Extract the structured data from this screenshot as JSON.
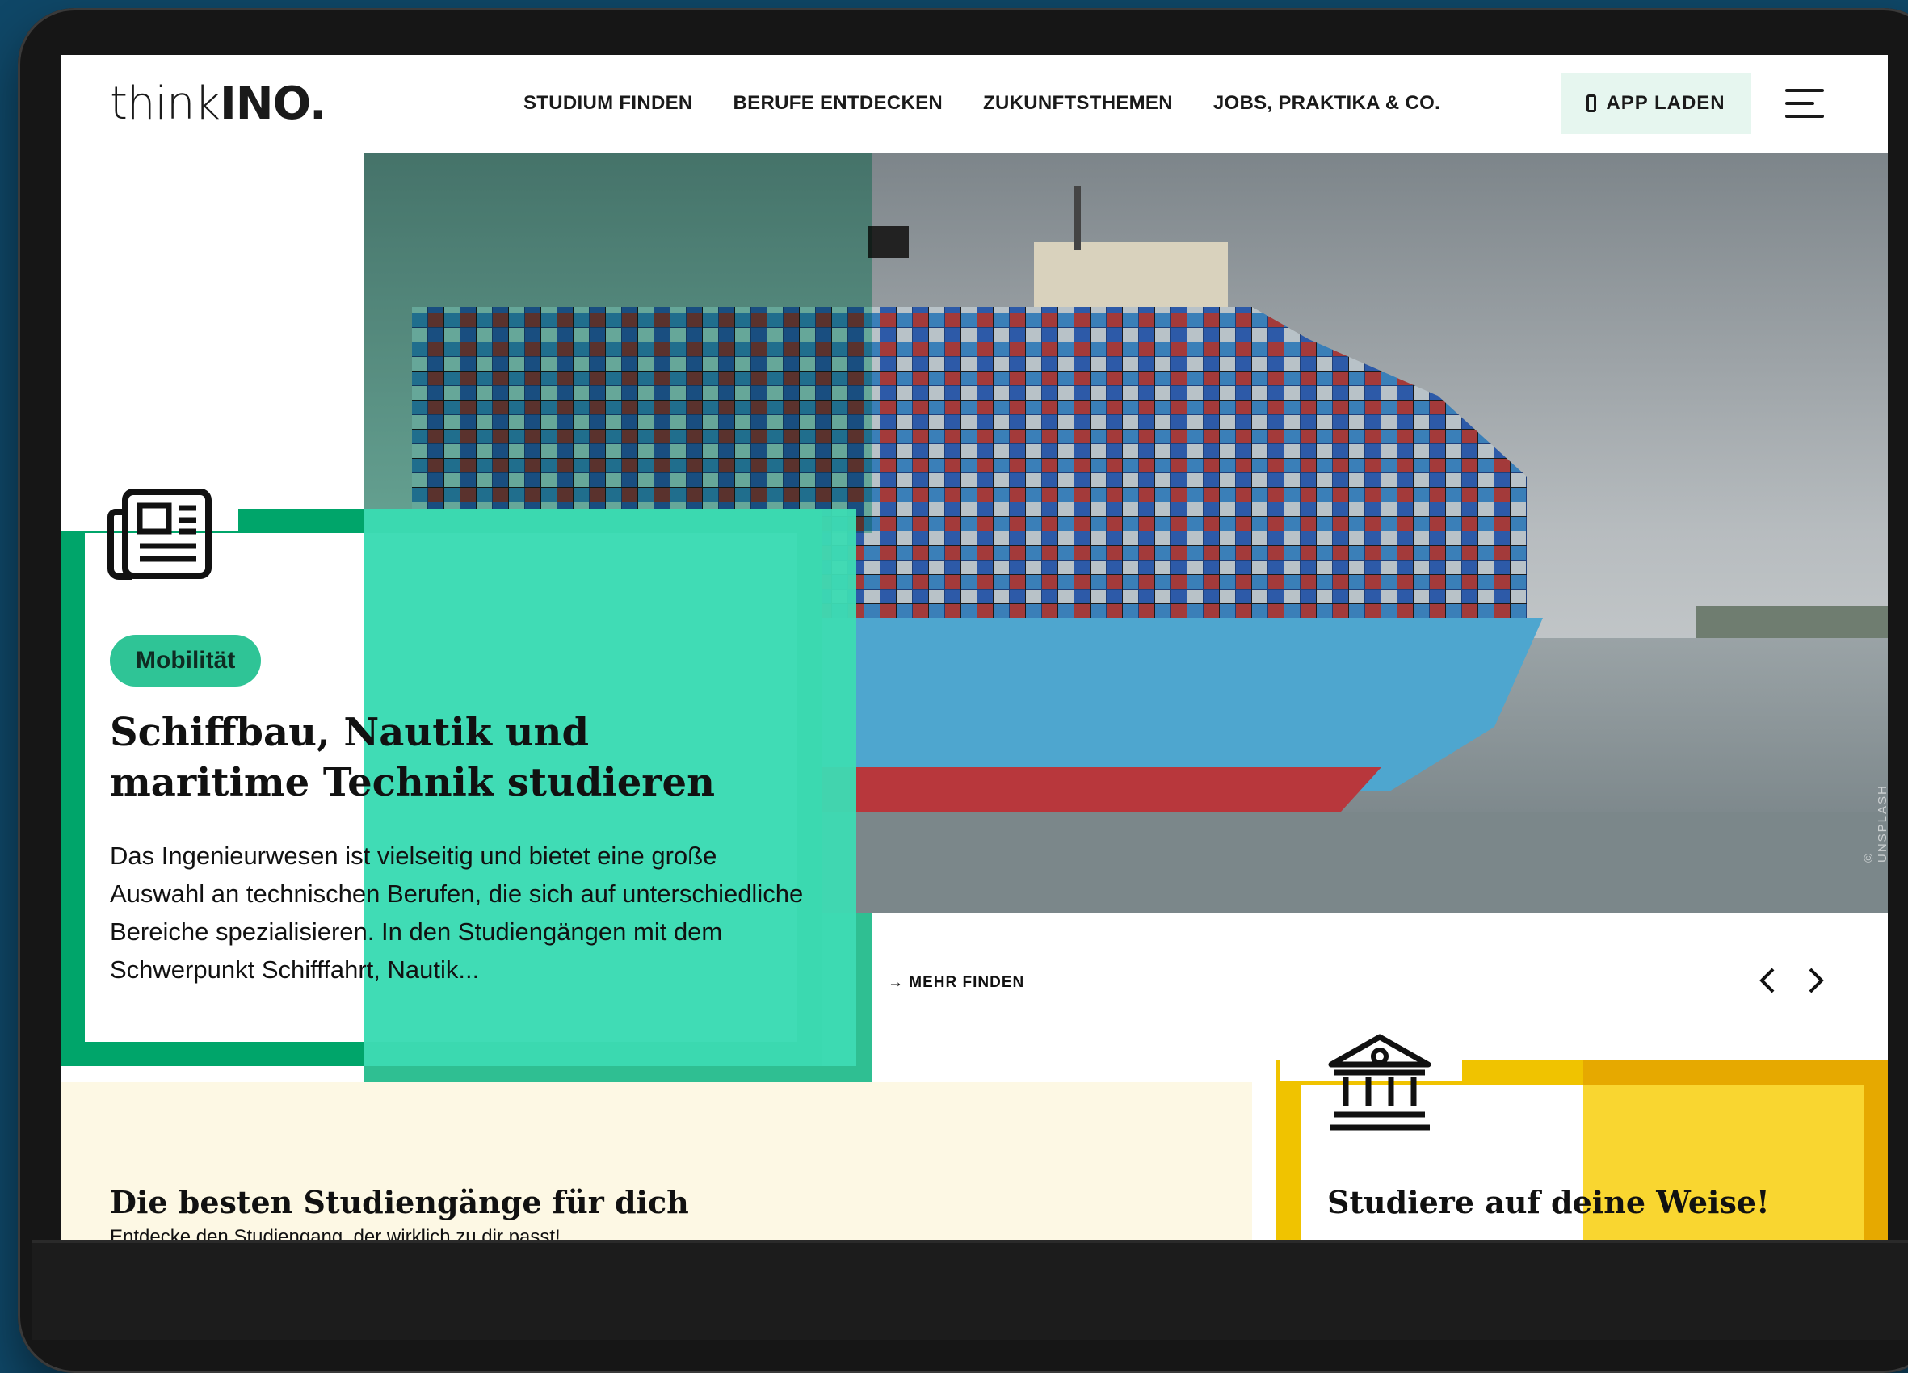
{
  "brand": {
    "logo_light": "think",
    "logo_bold": "INO."
  },
  "nav": {
    "items": [
      "STUDIUM FINDEN",
      "BERUFE ENTDECKEN",
      "ZUKUNFTSTHEMEN",
      "JOBS, PRAKTIKA & CO."
    ]
  },
  "header": {
    "app_button_label": "APP LADEN"
  },
  "hero": {
    "tag": "Mobilität",
    "title_line1": "Schiffbau, Nautik und",
    "title_line2": "maritime Technik studieren",
    "text": "Das Ingenieurwesen ist vielseitig und bietet eine große Auswahl an technischen Berufen, die sich auf unterschiedliche Bereiche spezialisieren. In den Studiengängen mit dem Schwerpunkt Schifffahrt, Nautik...",
    "image_credit": "© UNSPLASH",
    "more_link": "→ MEHR FINDEN"
  },
  "cards": [
    {
      "title": "Die besten Studiengänge für dich",
      "subtitle": "Entdecke den Studiengang, der wirklich zu dir passt!"
    },
    {
      "title": "Studiere auf deine Weise!"
    }
  ],
  "icons": [
    "newspaper-icon",
    "bank-icon",
    "phone-icon",
    "menu-icon",
    "chevron-left-icon",
    "chevron-right-icon"
  ],
  "colors": {
    "green": "#00a56a",
    "mint": "#40dcb5",
    "yellow": "#f0c300",
    "dark_bg": "#0f4767"
  }
}
